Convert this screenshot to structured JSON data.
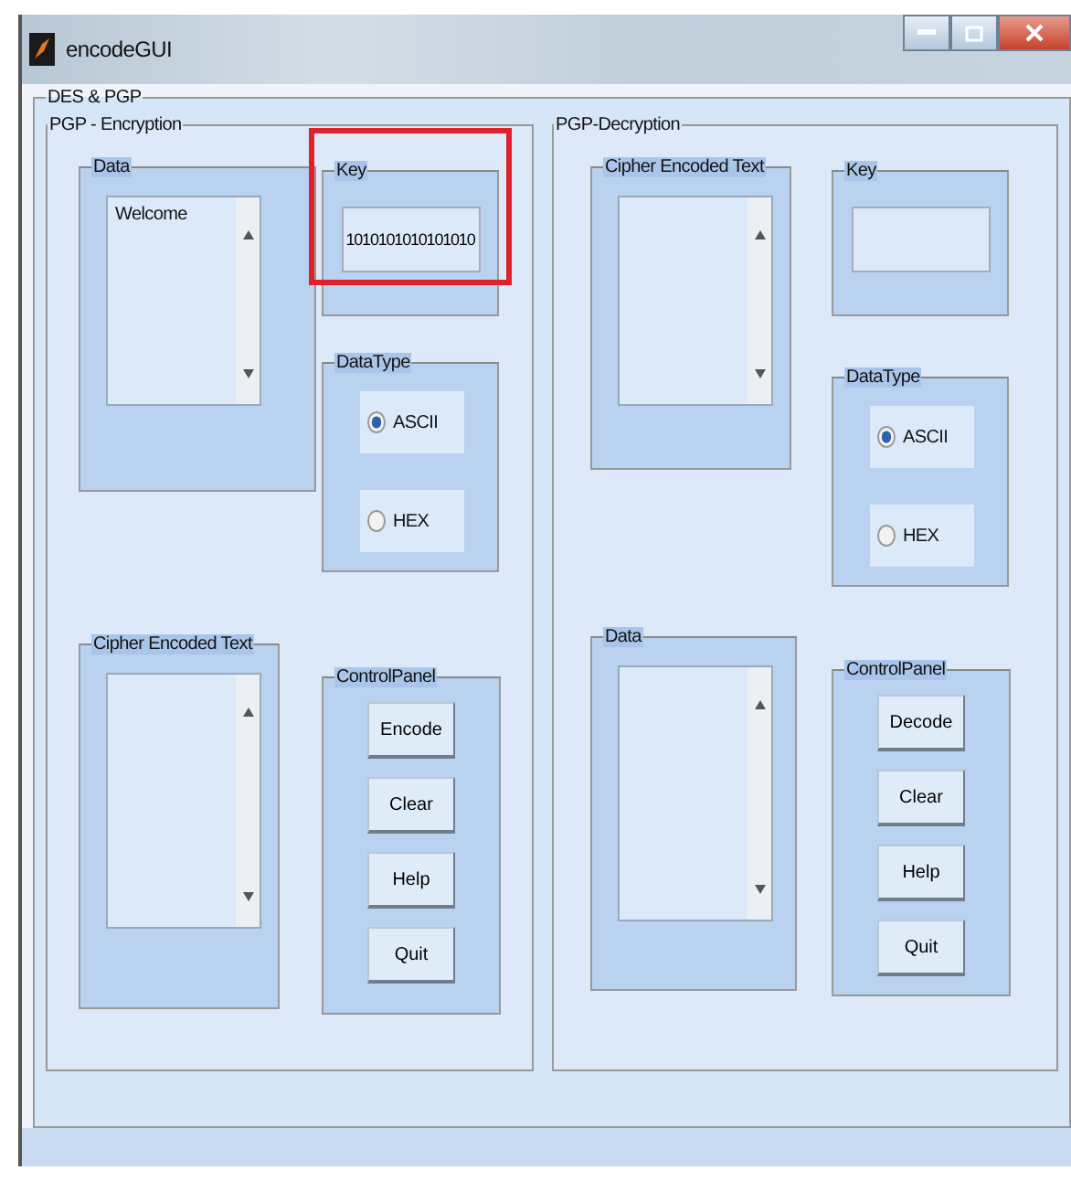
{
  "window": {
    "title": "encodeGUI"
  },
  "main_panel": {
    "title": "DES & PGP"
  },
  "panels": [
    {
      "title": "PGP - Encryption",
      "top_box": {
        "title": "Data",
        "value": "Welcome"
      },
      "key": {
        "title": "Key",
        "value": "1010101010101010"
      },
      "datatype": {
        "title": "DataType",
        "options": [
          {
            "label": "ASCII",
            "selected": true
          },
          {
            "label": "HEX",
            "selected": false
          }
        ]
      },
      "bottom_box": {
        "title": "Cipher Encoded Text"
      },
      "control_panel": {
        "title": "ControlPanel",
        "buttons": [
          "Encode",
          "Clear",
          "Help",
          "Quit"
        ]
      }
    },
    {
      "title": "PGP-Decryption",
      "top_box": {
        "title": "Cipher Encoded Text"
      },
      "key": {
        "title": "Key"
      },
      "datatype": {
        "title": "DataType",
        "options": [
          {
            "label": "ASCII",
            "selected": true
          },
          {
            "label": "HEX",
            "selected": false
          }
        ]
      },
      "bottom_box": {
        "title": "Data"
      },
      "control_panel": {
        "title": "ControlPanel",
        "buttons": [
          "Decode",
          "Clear",
          "Help",
          "Quit"
        ]
      }
    }
  ]
}
